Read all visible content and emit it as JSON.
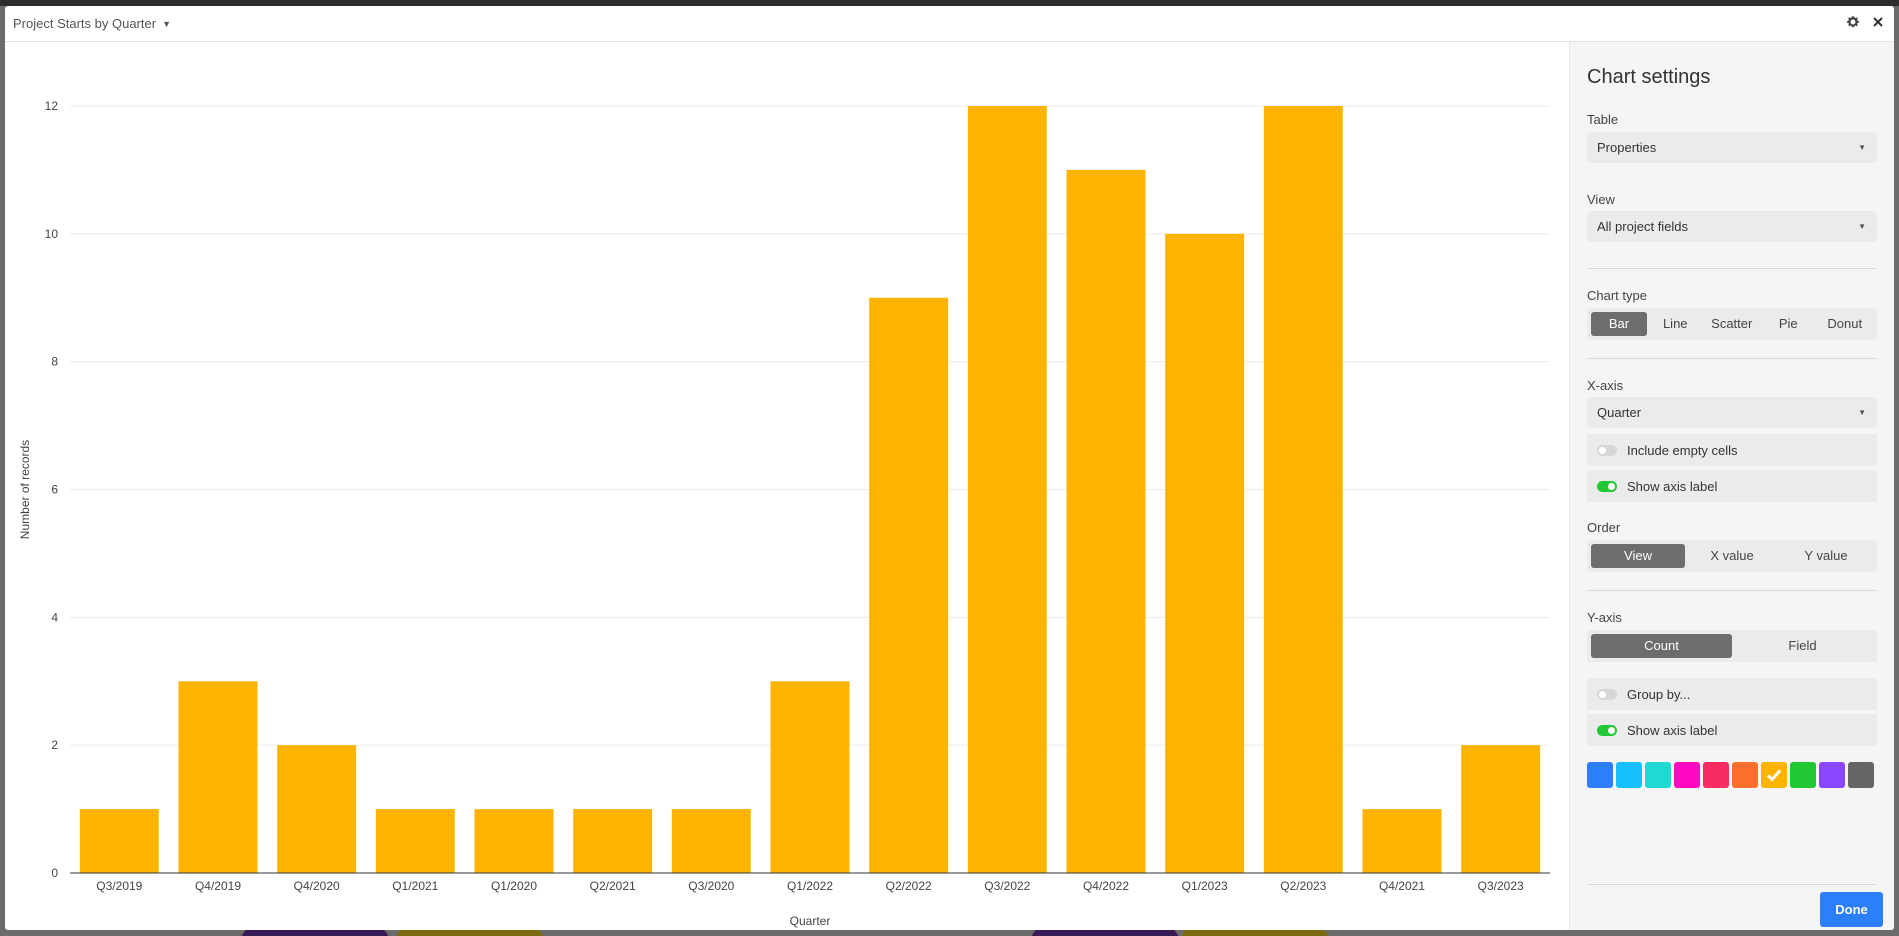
{
  "header": {
    "title": "Project Starts by Quarter"
  },
  "chart_data": {
    "type": "bar",
    "categories": [
      "Q3/2019",
      "Q4/2019",
      "Q4/2020",
      "Q1/2021",
      "Q1/2020",
      "Q2/2021",
      "Q3/2020",
      "Q1/2022",
      "Q2/2022",
      "Q3/2022",
      "Q4/2022",
      "Q1/2023",
      "Q2/2023",
      "Q4/2021",
      "Q3/2023"
    ],
    "values": [
      1,
      3,
      2,
      1,
      1,
      1,
      1,
      3,
      9,
      12,
      11,
      10,
      12,
      1,
      2
    ],
    "xlabel": "Quarter",
    "ylabel": "Number of records",
    "ylim": [
      0,
      12
    ],
    "yticks": [
      0,
      2,
      4,
      6,
      8,
      10,
      12
    ],
    "color": "#fcb400",
    "grid": true
  },
  "settings": {
    "title": "Chart settings",
    "table_label": "Table",
    "table_value": "Properties",
    "view_label": "View",
    "view_value": "All project fields",
    "chart_type_label": "Chart type",
    "chart_types": [
      "Bar",
      "Line",
      "Scatter",
      "Pie",
      "Donut"
    ],
    "chart_type_selected": "Bar",
    "xaxis_label": "X-axis",
    "xaxis_value": "Quarter",
    "include_empty_cells": "Include empty cells",
    "show_axis_label_x": "Show axis label",
    "order_label": "Order",
    "order_options": [
      "View",
      "X value",
      "Y value"
    ],
    "order_selected": "View",
    "yaxis_label": "Y-axis",
    "yaxis_options": [
      "Count",
      "Field"
    ],
    "yaxis_selected": "Count",
    "group_by": "Group by...",
    "show_axis_label_y": "Show axis label",
    "colors": [
      "#2d7ff9",
      "#18bfff",
      "#20d9d2",
      "#ff08c2",
      "#f82b60",
      "#ff6f2c",
      "#fcb400",
      "#20c933",
      "#8b46ff",
      "#666666"
    ],
    "selected_color": "#fcb400",
    "done_label": "Done"
  }
}
